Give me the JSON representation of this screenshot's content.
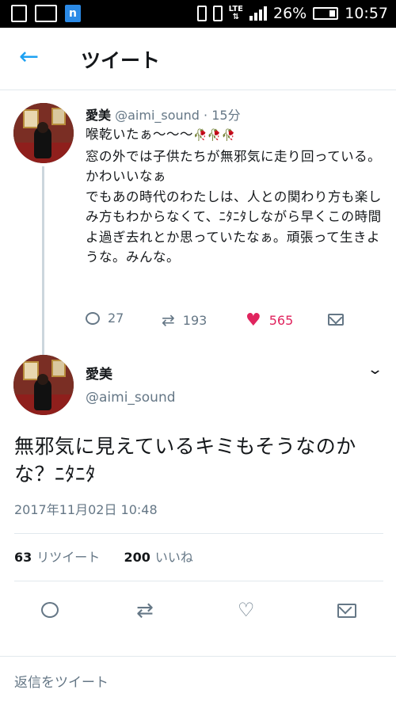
{
  "status_bar": {
    "battery": "26%",
    "time": "10:57",
    "lte": "LTE",
    "app_icon_letter": "n"
  },
  "header": {
    "back_glyph": "←",
    "title": "ツイート"
  },
  "tweet1": {
    "name": "愛美",
    "handle": "@aimi_sound",
    "time": "· 15分",
    "body_line1": "喉乾いたぁ〜〜〜",
    "emoji_text": "🥀🥀🥀",
    "body_rest": "窓の外では子供たちが無邪気に走り回っている。かわいいなぁ\nでもあの時代のわたしは、人との関わり方も楽しみ方もわからなくて、ﾆﾀﾆﾀしながら早くこの時間よ過ぎ去れとか思っていたなぁ。頑張って生きような。みんな。",
    "replies": "27",
    "retweets": "193",
    "likes": "565"
  },
  "tweet2": {
    "name": "愛美",
    "handle": "@aimi_sound",
    "body": "無邪気に見えているキミもそうなのかな？ﾆﾀﾆﾀ",
    "timestamp": "2017年11月02日 10:48",
    "retweet_count": "63",
    "retweet_label": "リツイート",
    "like_count": "200",
    "like_label": "いいね"
  },
  "reply_box": {
    "placeholder": "返信をツイート"
  },
  "colors": {
    "accent": "#1da1f2",
    "like": "#e0245e",
    "muted": "#657786"
  }
}
